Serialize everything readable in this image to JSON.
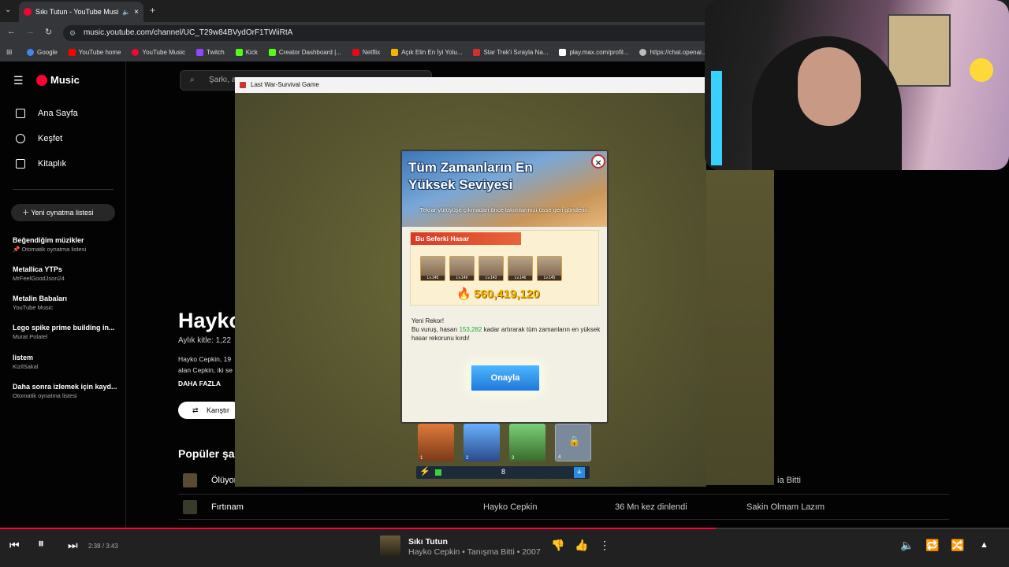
{
  "browser": {
    "tab_title": "Sıkı Tutun - YouTube Music",
    "url": "music.youtube.com/channel/UC_T29w84BVydOrF1TWiiRtA",
    "bookmarks": [
      "Google",
      "YouTube home",
      "YouTube Music",
      "Twitch",
      "Kick",
      "Creator Dashboard |...",
      "Netflix",
      "Açık Elin En İyi Yolu...",
      "Star Trek'i Sırayla Na...",
      "play.max.com/profil...",
      "https://chat.openai...."
    ]
  },
  "yt": {
    "logo": "Music",
    "search_placeholder": "Şarkı, a",
    "nav": [
      "Ana Sayfa",
      "Keşfet",
      "Kitaplık"
    ],
    "new_playlist": "Yeni oynatma listesi",
    "playlists": [
      {
        "title": "Beğendiğim müzikler",
        "sub": "Otomatik oynatma listesi"
      },
      {
        "title": "Metallica YTPs",
        "sub": "MrFeelGoodJson24"
      },
      {
        "title": "Metalin Babaları",
        "sub": "YouTube Music"
      },
      {
        "title": "Lego spike prime building in...",
        "sub": "Murat Polatel"
      },
      {
        "title": "listem",
        "sub": "KizilSakal"
      },
      {
        "title": "Daha sonra izlemek için kayd...",
        "sub": "Otomatik oynatma listesi"
      }
    ],
    "artist": {
      "name": "Hayko",
      "monthly": "Aylık kitle: 1,22",
      "bio_line1": "Hayko Cepkin, 19",
      "bio_line2": "alan Cepkin, iki se",
      "more": "DAHA FAZLA",
      "shuffle": "Karıştır"
    },
    "popular_heading": "Popüler şa",
    "rows": [
      {
        "title": "Ölüyor",
        "artist": "",
        "plays": "",
        "album": "ia Bitti"
      },
      {
        "title": "Fırtınam",
        "artist": "Hayko Cepkin",
        "plays": "36 Mn kez dinlendi",
        "album": "Sakin Olmam Lazım"
      }
    ]
  },
  "game": {
    "window_title": "Last War-Survival Game",
    "modal": {
      "title": "Tüm Zamanların En Yüksek Seviyesi",
      "subtitle": "Tekrar yürüyüşe çıkmadan önce takımlarınızı üsse geri gönderin.",
      "damage_label": "Bu Seferki Hasar",
      "hero_levels": [
        "Lv.145",
        "Lv.149",
        "Lv.143",
        "Lv.146",
        "Lv.145"
      ],
      "damage_value": "560,419,120",
      "record_title": "Yeni Rekor!",
      "record_pre": "Bu vuruş, hasarı ",
      "record_value": "153,282",
      "record_post": " kadar artırarak tüm zamanların en yüksek hasar rekorunu kırdı!",
      "confirm": "Onayla"
    },
    "slots": [
      "1",
      "2",
      "3",
      "4"
    ],
    "energy_count": "8"
  },
  "player": {
    "time": "2:38 / 3:43",
    "progress": 0.709,
    "song": "Sıkı Tutun",
    "meta": "Hayko Cepkin • Tanışma Bitti • 2007"
  },
  "colors": {
    "accent": "#ff0033",
    "game_btn": "#1f78d8",
    "record_green": "#1fa83a"
  }
}
